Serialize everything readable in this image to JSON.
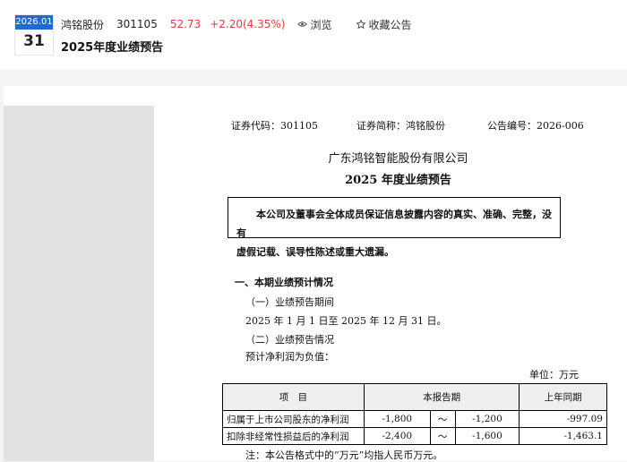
{
  "header": {
    "date_month": "2026.01",
    "date_day": "31",
    "stock_name": "鸿铭股份",
    "stock_code": "301105",
    "price": "52.73",
    "change": "+2.20(4.35%)",
    "browse_label": "浏览",
    "favorite_label": "收藏公告",
    "title": "2025年度业绩预告",
    "colors": {
      "accent": "#1f6ad4",
      "up": "#e23c3c"
    }
  },
  "doc": {
    "code_line": "证券代码：301105",
    "abbr_line": "证券简称：鸿铭股份",
    "ann_line": "公告编号：2026-006",
    "company": "广东鸿铭智能股份有限公司",
    "title": "2025 年度业绩预告",
    "notice_l1": "本公司及董事会全体成员保证信息披露内容的真实、准确、完整，没有",
    "notice_l2": "虚假记载、误导性陈述或重大遗漏。",
    "sec1": "一、本期业绩预计情况",
    "sub1": "（一）业绩预告期间",
    "period": "2025 年 1 月 1 日至 2025 年 12 月 31 日。",
    "sub2": "（二）业绩预告情况",
    "expect": "预计净利润为负值：",
    "unit": "单位：万元",
    "table": {
      "h_item": "项　目",
      "h_current": "本报告期",
      "h_last": "上年同期",
      "rows": [
        {
          "item": "归属于上市公司股东的净利润",
          "low": "-1,800",
          "tilde": "～",
          "high": "-1,200",
          "last": "-997.09"
        },
        {
          "item": "扣除非经常性损益后的净利润",
          "low": "-2,400",
          "tilde": "～",
          "high": "-1,600",
          "last": "-1,463.1"
        }
      ]
    },
    "note": "注：本公告格式中的“万元”均指人民币万元。"
  }
}
